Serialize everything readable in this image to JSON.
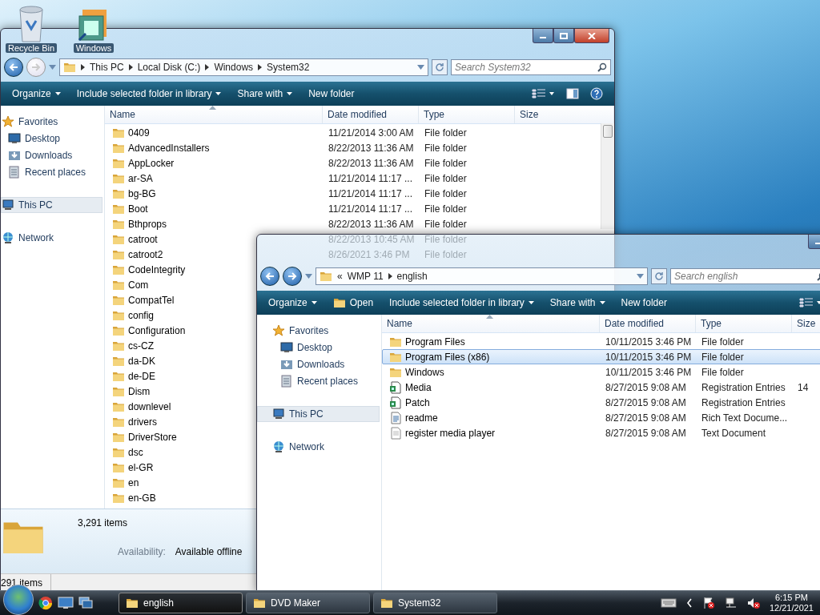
{
  "desktop_icons": [
    {
      "label": "Recycle Bin",
      "kind": "recycle"
    },
    {
      "label": "Windows",
      "kind": "app"
    }
  ],
  "windows": [
    {
      "address": {
        "crumbs": [
          "This PC",
          "Local Disk (C:)",
          "Windows",
          "System32"
        ]
      },
      "search": {
        "placeholder": "Search System32"
      },
      "toolbar": [
        {
          "label": "Organize",
          "kind": "menu",
          "dropdown": true
        },
        {
          "label": "Include selected folder in library",
          "kind": "menu",
          "dropdown": true
        },
        {
          "label": "Share with",
          "kind": "menu",
          "dropdown": true
        },
        {
          "label": "New folder",
          "kind": "menu",
          "dropdown": false
        }
      ],
      "nav": [
        {
          "label": "Favorites",
          "kind": "favorites",
          "selected": false,
          "children": [
            {
              "label": "Desktop",
              "kind": "desktop",
              "selected": false
            },
            {
              "label": "Downloads",
              "kind": "downloads",
              "selected": false
            },
            {
              "label": "Recent places",
              "kind": "recent",
              "selected": false
            }
          ]
        },
        {
          "label": "This PC",
          "kind": "computer",
          "selected": true
        },
        {
          "label": "Network",
          "kind": "network",
          "selected": false
        }
      ],
      "columns": [
        "Name",
        "Date modified",
        "Type",
        "Size"
      ],
      "rows": [
        {
          "name": "0409",
          "kind": "folder",
          "date": "11/21/2014 3:00 AM",
          "type": "File folder",
          "selected": false
        },
        {
          "name": "AdvancedInstallers",
          "kind": "folder",
          "date": "8/22/2013 11:36 AM",
          "type": "File folder",
          "selected": false
        },
        {
          "name": "AppLocker",
          "kind": "folder",
          "date": "8/22/2013 11:36 AM",
          "type": "File folder",
          "selected": false
        },
        {
          "name": "ar-SA",
          "kind": "folder",
          "date": "11/21/2014 11:17 ...",
          "type": "File folder",
          "selected": false
        },
        {
          "name": "bg-BG",
          "kind": "folder",
          "date": "11/21/2014 11:17 ...",
          "type": "File folder",
          "selected": false
        },
        {
          "name": "Boot",
          "kind": "folder",
          "date": "11/21/2014 11:17 ...",
          "type": "File folder",
          "selected": false
        },
        {
          "name": "Bthprops",
          "kind": "folder",
          "date": "8/22/2013 11:36 AM",
          "type": "File folder",
          "selected": false
        },
        {
          "name": "catroot",
          "kind": "folder",
          "date": "8/22/2013 10:45 AM",
          "type": "File folder",
          "selected": false
        },
        {
          "name": "catroot2",
          "kind": "folder",
          "date": "8/26/2021 3:46 PM",
          "type": "File folder",
          "selected": false
        },
        {
          "name": "CodeIntegrity",
          "kind": "folder",
          "selected": false
        },
        {
          "name": "Com",
          "kind": "folder",
          "selected": false
        },
        {
          "name": "CompatTel",
          "kind": "folder",
          "selected": false
        },
        {
          "name": "config",
          "kind": "folder",
          "selected": false
        },
        {
          "name": "Configuration",
          "kind": "folder",
          "selected": false
        },
        {
          "name": "cs-CZ",
          "kind": "folder",
          "selected": false
        },
        {
          "name": "da-DK",
          "kind": "folder",
          "selected": false
        },
        {
          "name": "de-DE",
          "kind": "folder",
          "selected": false
        },
        {
          "name": "Dism",
          "kind": "folder",
          "selected": false
        },
        {
          "name": "downlevel",
          "kind": "folder",
          "selected": false
        },
        {
          "name": "drivers",
          "kind": "folder",
          "selected": false
        },
        {
          "name": "DriverStore",
          "kind": "folder",
          "selected": false
        },
        {
          "name": "dsc",
          "kind": "folder",
          "selected": false
        },
        {
          "name": "el-GR",
          "kind": "folder",
          "selected": false
        },
        {
          "name": "en",
          "kind": "folder",
          "selected": false
        },
        {
          "name": "en-GB",
          "kind": "folder",
          "selected": false
        }
      ],
      "details": {
        "count": "3,291 items",
        "label": "Availability:",
        "value": "Available offline"
      },
      "status_bar": "291 items"
    },
    {
      "address": {
        "overflow": "«",
        "crumbs": [
          "WMP 11",
          "english"
        ]
      },
      "search": {
        "placeholder": "Search english"
      },
      "toolbar": [
        {
          "label": "Organize",
          "kind": "menu",
          "dropdown": true
        },
        {
          "label": "Open",
          "kind": "open",
          "dropdown": false
        },
        {
          "label": "Include selected folder in library",
          "kind": "menu",
          "dropdown": true
        },
        {
          "label": "Share with",
          "kind": "menu",
          "dropdown": true
        },
        {
          "label": "New folder",
          "kind": "menu",
          "dropdown": false
        }
      ],
      "nav": [
        {
          "label": "Favorites",
          "kind": "favorites",
          "selected": false,
          "children": [
            {
              "label": "Desktop",
              "kind": "desktop",
              "selected": false
            },
            {
              "label": "Downloads",
              "kind": "downloads",
              "selected": false
            },
            {
              "label": "Recent places",
              "kind": "recent",
              "selected": false
            }
          ]
        },
        {
          "label": "This PC",
          "kind": "computer",
          "selected": true
        },
        {
          "label": "Network",
          "kind": "network",
          "selected": false
        }
      ],
      "columns": [
        "Name",
        "Date modified",
        "Type",
        "Size"
      ],
      "rows": [
        {
          "name": "Program Files",
          "kind": "folder",
          "date": "10/11/2015 3:46 PM",
          "type": "File folder",
          "selected": false
        },
        {
          "name": "Program Files (x86)",
          "kind": "folder",
          "date": "10/11/2015 3:46 PM",
          "type": "File folder",
          "selected": true
        },
        {
          "name": "Windows",
          "kind": "folder",
          "date": "10/11/2015 3:46 PM",
          "type": "File folder",
          "selected": false
        },
        {
          "name": "Media",
          "kind": "reg",
          "date": "8/27/2015 9:08 AM",
          "type": "Registration Entries",
          "size": "14",
          "selected": false
        },
        {
          "name": "Patch",
          "kind": "reg",
          "date": "8/27/2015 9:08 AM",
          "type": "Registration Entries",
          "selected": false
        },
        {
          "name": "readme",
          "kind": "rtf",
          "date": "8/27/2015 9:08 AM",
          "type": "Rich Text Docume...",
          "selected": false
        },
        {
          "name": "register media player",
          "kind": "txt",
          "date": "8/27/2015 9:08 AM",
          "type": "Text Document",
          "selected": false
        }
      ]
    }
  ],
  "taskbar": {
    "buttons": [
      {
        "label": "english",
        "selected": true
      },
      {
        "label": "DVD Maker",
        "selected": false
      },
      {
        "label": "System32",
        "selected": false
      }
    ],
    "time": "6:15 PM",
    "date": "12/21/2021"
  }
}
